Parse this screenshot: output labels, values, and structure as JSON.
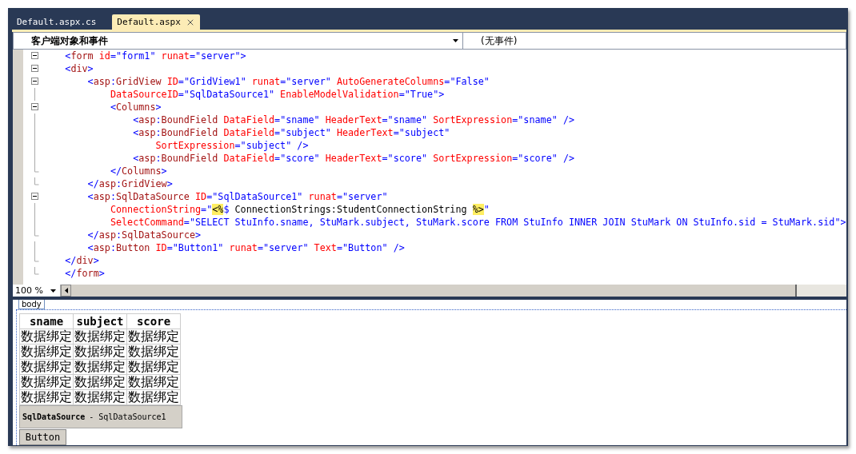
{
  "tabs": [
    {
      "label": "Default.aspx.cs",
      "selected": false
    },
    {
      "label": "Default.aspx",
      "selected": true
    }
  ],
  "navigation_bar": {
    "object_dropdown": {
      "value": "客户端对象和事件"
    },
    "event_dropdown": {
      "value": "(无事件)"
    }
  },
  "code_lines": [
    {
      "kind": "start",
      "tokens": [
        {
          "kind": "delim",
          "text": "    <"
        },
        {
          "kind": "tag",
          "text": "form"
        },
        {
          "kind": "attr",
          "text": " id"
        },
        {
          "kind": "value",
          "text": "=\"form1\""
        },
        {
          "kind": "attr",
          "text": " runat"
        },
        {
          "kind": "value",
          "text": "=\"server\">"
        }
      ]
    },
    {
      "kind": "start",
      "tokens": [
        {
          "kind": "delim",
          "text": "    <"
        },
        {
          "kind": "tag",
          "text": "div"
        },
        {
          "kind": "delim",
          "text": ">"
        }
      ]
    },
    {
      "kind": "start",
      "tokens": [
        {
          "kind": "delim",
          "text": "        <"
        },
        {
          "kind": "tag",
          "text": "asp"
        },
        {
          "kind": "delim",
          "text": ":"
        },
        {
          "kind": "tag",
          "text": "GridView"
        },
        {
          "kind": "attr",
          "text": " ID"
        },
        {
          "kind": "value",
          "text": "=\"GridView1\""
        },
        {
          "kind": "attr",
          "text": " runat"
        },
        {
          "kind": "value",
          "text": "=\"server\""
        },
        {
          "kind": "attr",
          "text": " AutoGenerateColumns"
        },
        {
          "kind": "value",
          "text": "=\"False\""
        }
      ]
    },
    {
      "kind": "inner",
      "tokens": [
        {
          "kind": "attr",
          "text": "            DataSourceID"
        },
        {
          "kind": "value",
          "text": "=\"SqlDataSource1\""
        },
        {
          "kind": "attr",
          "text": " EnableModelValidation"
        },
        {
          "kind": "value",
          "text": "=\"True\">"
        }
      ]
    },
    {
      "kind": "start",
      "tokens": [
        {
          "kind": "delim",
          "text": "            <"
        },
        {
          "kind": "tag",
          "text": "Columns"
        },
        {
          "kind": "delim",
          "text": ">"
        }
      ]
    },
    {
      "kind": "inner",
      "tokens": [
        {
          "kind": "delim",
          "text": "                <"
        },
        {
          "kind": "tag",
          "text": "asp"
        },
        {
          "kind": "delim",
          "text": ":"
        },
        {
          "kind": "tag",
          "text": "BoundField"
        },
        {
          "kind": "attr",
          "text": " DataField"
        },
        {
          "kind": "value",
          "text": "=\"sname\""
        },
        {
          "kind": "attr",
          "text": " HeaderText"
        },
        {
          "kind": "value",
          "text": "=\"sname\""
        },
        {
          "kind": "attr",
          "text": " SortExpression"
        },
        {
          "kind": "value",
          "text": "=\"sname\" />"
        }
      ]
    },
    {
      "kind": "inner",
      "tokens": [
        {
          "kind": "delim",
          "text": "                <"
        },
        {
          "kind": "tag",
          "text": "asp"
        },
        {
          "kind": "delim",
          "text": ":"
        },
        {
          "kind": "tag",
          "text": "BoundField"
        },
        {
          "kind": "attr",
          "text": " DataField"
        },
        {
          "kind": "value",
          "text": "=\"subject\""
        },
        {
          "kind": "attr",
          "text": " HeaderText"
        },
        {
          "kind": "value",
          "text": "=\"subject\""
        }
      ]
    },
    {
      "kind": "inner",
      "tokens": [
        {
          "kind": "attr",
          "text": "                    SortExpression"
        },
        {
          "kind": "value",
          "text": "=\"subject\" />"
        }
      ]
    },
    {
      "kind": "inner",
      "tokens": [
        {
          "kind": "delim",
          "text": "                <"
        },
        {
          "kind": "tag",
          "text": "asp"
        },
        {
          "kind": "delim",
          "text": ":"
        },
        {
          "kind": "tag",
          "text": "BoundField"
        },
        {
          "kind": "attr",
          "text": " DataField"
        },
        {
          "kind": "value",
          "text": "=\"score\""
        },
        {
          "kind": "attr",
          "text": " HeaderText"
        },
        {
          "kind": "value",
          "text": "=\"score\""
        },
        {
          "kind": "attr",
          "text": " SortExpression"
        },
        {
          "kind": "value",
          "text": "=\"score\" />"
        }
      ]
    },
    {
      "kind": "end",
      "tokens": [
        {
          "kind": "delim",
          "text": "            </"
        },
        {
          "kind": "tag",
          "text": "Columns"
        },
        {
          "kind": "delim",
          "text": ">"
        }
      ]
    },
    {
      "kind": "end",
      "tokens": [
        {
          "kind": "delim",
          "text": "        </"
        },
        {
          "kind": "tag",
          "text": "asp"
        },
        {
          "kind": "delim",
          "text": ":"
        },
        {
          "kind": "tag",
          "text": "GridView"
        },
        {
          "kind": "delim",
          "text": ">"
        }
      ]
    },
    {
      "kind": "start",
      "tokens": [
        {
          "kind": "delim",
          "text": "        <"
        },
        {
          "kind": "tag",
          "text": "asp"
        },
        {
          "kind": "delim",
          "text": ":"
        },
        {
          "kind": "tag",
          "text": "SqlDataSource"
        },
        {
          "kind": "attr",
          "text": " ID"
        },
        {
          "kind": "value",
          "text": "=\"SqlDataSource1\""
        },
        {
          "kind": "attr",
          "text": " runat"
        },
        {
          "kind": "value",
          "text": "=\"server\""
        }
      ]
    },
    {
      "kind": "inner",
      "tokens": [
        {
          "kind": "attr",
          "text": "            ConnectionString"
        },
        {
          "kind": "value",
          "text": "=\""
        },
        {
          "kind": "highlight",
          "text": "<%"
        },
        {
          "kind": "value",
          "text": "$"
        },
        {
          "kind": "text",
          "text": " ConnectionStrings:StudentConnectionString "
        },
        {
          "kind": "highlight",
          "text": "%>"
        },
        {
          "kind": "value",
          "text": "\""
        }
      ]
    },
    {
      "kind": "inner",
      "tokens": [
        {
          "kind": "attr",
          "text": "            SelectCommand"
        },
        {
          "kind": "value",
          "text": "=\"SELECT StuInfo.sname, StuMark.subject, StuMark.score FROM StuInfo INNER JOIN StuMark ON StuInfo.sid = StuMark.sid\">"
        }
      ]
    },
    {
      "kind": "end",
      "tokens": [
        {
          "kind": "delim",
          "text": "        </"
        },
        {
          "kind": "tag",
          "text": "asp"
        },
        {
          "kind": "delim",
          "text": ":"
        },
        {
          "kind": "tag",
          "text": "SqlDataSource"
        },
        {
          "kind": "delim",
          "text": ">"
        }
      ]
    },
    {
      "kind": "inner",
      "tokens": [
        {
          "kind": "delim",
          "text": "        <"
        },
        {
          "kind": "tag",
          "text": "asp"
        },
        {
          "kind": "delim",
          "text": ":"
        },
        {
          "kind": "tag",
          "text": "Button"
        },
        {
          "kind": "attr",
          "text": " ID"
        },
        {
          "kind": "value",
          "text": "=\"Button1\""
        },
        {
          "kind": "attr",
          "text": " runat"
        },
        {
          "kind": "value",
          "text": "=\"server\""
        },
        {
          "kind": "attr",
          "text": " Text"
        },
        {
          "kind": "value",
          "text": "=\"Button\" />"
        }
      ]
    },
    {
      "kind": "end",
      "tokens": [
        {
          "kind": "delim",
          "text": "    </"
        },
        {
          "kind": "tag",
          "text": "div"
        },
        {
          "kind": "delim",
          "text": ">"
        }
      ]
    },
    {
      "kind": "end",
      "tokens": [
        {
          "kind": "delim",
          "text": "    </"
        },
        {
          "kind": "tag",
          "text": "form"
        },
        {
          "kind": "delim",
          "text": ">"
        }
      ]
    }
  ],
  "zoom": {
    "value": "100 %"
  },
  "design_view": {
    "tag": "body",
    "grid": {
      "columns": [
        "sname",
        "subject",
        "score"
      ],
      "rows": [
        [
          "数据绑定",
          "数据绑定",
          "数据绑定"
        ],
        [
          "数据绑定",
          "数据绑定",
          "数据绑定"
        ],
        [
          "数据绑定",
          "数据绑定",
          "数据绑定"
        ],
        [
          "数据绑定",
          "数据绑定",
          "数据绑定"
        ],
        [
          "数据绑定",
          "数据绑定",
          "数据绑定"
        ]
      ]
    },
    "data_source": {
      "type": "SqlDataSource",
      "name": "- SqlDataSource1"
    },
    "button": "Button"
  }
}
